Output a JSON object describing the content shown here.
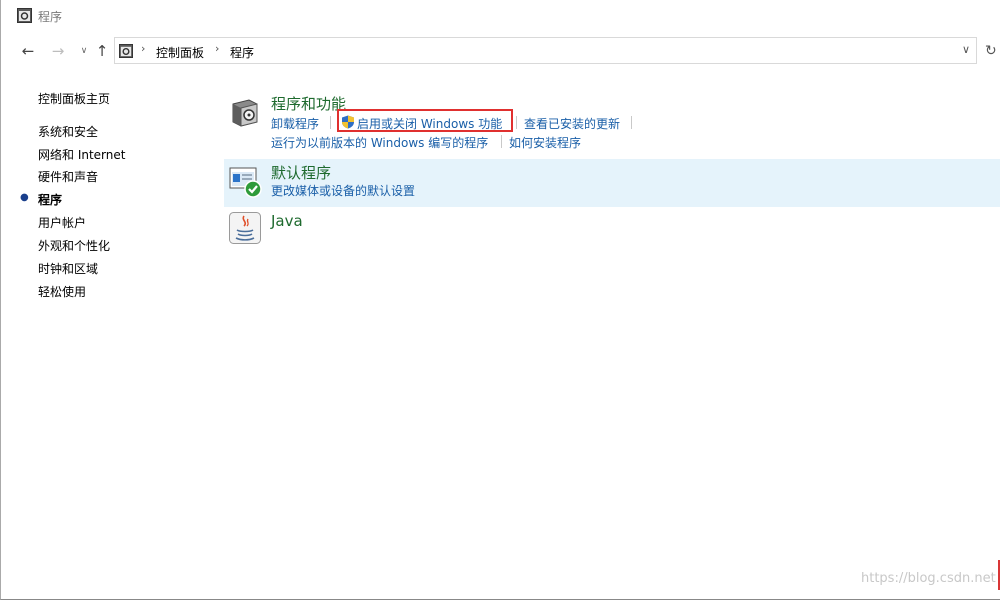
{
  "window": {
    "title": "程序"
  },
  "nav": {
    "breadcrumb": [
      "控制面板",
      "程序"
    ]
  },
  "leftnav": {
    "items": [
      {
        "label": "控制面板主页",
        "current": false
      },
      {
        "label": "系统和安全",
        "current": false
      },
      {
        "label": "网络和 Internet",
        "current": false
      },
      {
        "label": "硬件和声音",
        "current": false
      },
      {
        "label": "程序",
        "current": true
      },
      {
        "label": "用户帐户",
        "current": false
      },
      {
        "label": "外观和个性化",
        "current": false
      },
      {
        "label": "时钟和区域",
        "current": false
      },
      {
        "label": "轻松使用",
        "current": false
      }
    ]
  },
  "main": {
    "programs_features": {
      "title": "程序和功能",
      "links": [
        "卸载程序",
        "启用或关闭 Windows 功能",
        "查看已安装的更新",
        "运行为以前版本的 Windows 编写的程序",
        "如何安装程序"
      ]
    },
    "default_programs": {
      "title": "默认程序",
      "links": [
        "更改媒体或设备的默认设置"
      ]
    },
    "java": {
      "title": "Java"
    }
  },
  "watermark": "https://blog.csdn.net",
  "colors": {
    "category_title": "#1e6a2e",
    "link": "#1a5fa8",
    "highlight": "#e5f3fb",
    "annotation_box": "#e0302f"
  }
}
